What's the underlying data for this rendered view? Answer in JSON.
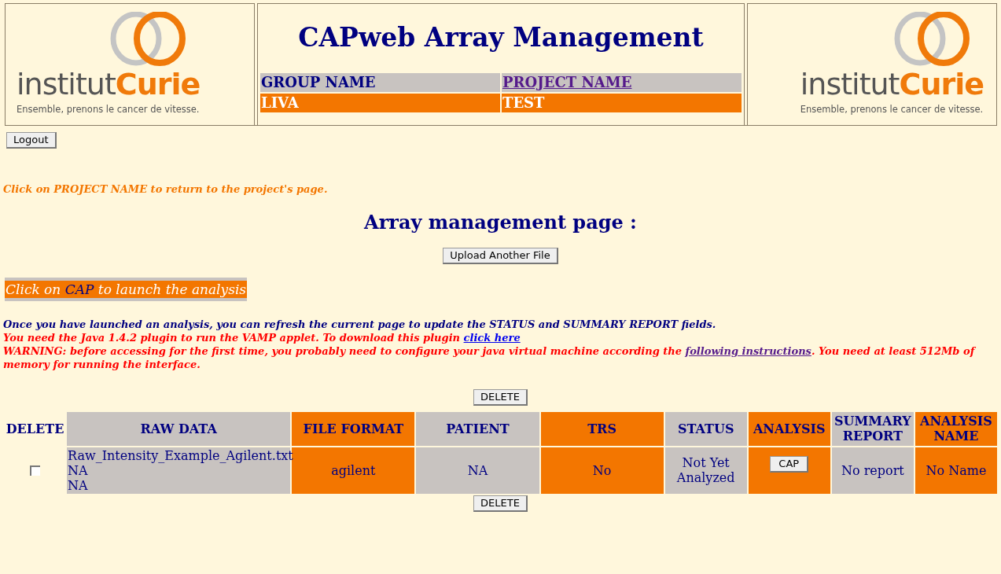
{
  "header": {
    "left_logo": {
      "name": "institut",
      "accent": "Curie",
      "tagline": "Ensemble, prenons le cancer de vitesse."
    },
    "title": "CAPweb Array Management",
    "info_table": {
      "columns": [
        {
          "label": "GROUP NAME",
          "link": false
        },
        {
          "label": "PROJECT NAME",
          "link": true
        }
      ],
      "values": [
        "LIVA",
        "TEST"
      ]
    },
    "right_logo": {
      "name": "institut",
      "accent": "Curie",
      "tagline": "Ensemble, prenons le cancer de vitesse."
    }
  },
  "logout_button": "Logout",
  "hint": "Click on PROJECT NAME to return to the project's page.",
  "page_heading": "Array management page :",
  "upload_button": "Upload Another File",
  "banner": {
    "before": "Click on ",
    "highlight": "CAP",
    "after": " to launch the analysis"
  },
  "notices": [
    {
      "kind": "info",
      "before": "Once you have launched an analysis, you can refresh the current page to update the STATUS and SUMMARY REPORT fields."
    },
    {
      "kind": "warning",
      "before": "You need the Java 1.4.2 plugin to run the VAMP applet. To download this plugin ",
      "link": "click here",
      "link_visited": false
    },
    {
      "kind": "warning",
      "before": "WARNING: before accessing for the first time, you probably need to configure your java virtual machine according the ",
      "link": "following instructions",
      "link_visited": true,
      "after": ". You need at least 512Mb of memory for running the interface."
    }
  ],
  "delete_button_top": "DELETE",
  "table": {
    "columns": [
      {
        "label": "DELETE"
      },
      {
        "label": "RAW DATA",
        "color": "#c8c3c0"
      },
      {
        "label": "FILE FORMAT",
        "color": "#f37600"
      },
      {
        "label": "PATIENT",
        "color": "#c8c3c0"
      },
      {
        "label": "TRS",
        "color": "#f37600"
      },
      {
        "label": "STATUS",
        "color": "#c8c3c0"
      },
      {
        "label": "ANALYSIS",
        "color": "#f37600"
      },
      {
        "label": "SUMMARY REPORT",
        "color": "#c8c3c0"
      },
      {
        "label": "ANALYSIS NAME",
        "color": "#f37600"
      }
    ],
    "rows": [
      {
        "checked": false,
        "raw_data": [
          "Raw_Intensity_Example_Agilent.txt",
          "NA",
          "NA"
        ],
        "file_format": "agilent",
        "patient": "NA",
        "trs": "No",
        "status": "Not Yet Analyzed",
        "analysis_button": "CAP",
        "summary_report": "No report",
        "analysis_name": "No Name"
      }
    ]
  },
  "delete_button_bottom": "DELETE"
}
